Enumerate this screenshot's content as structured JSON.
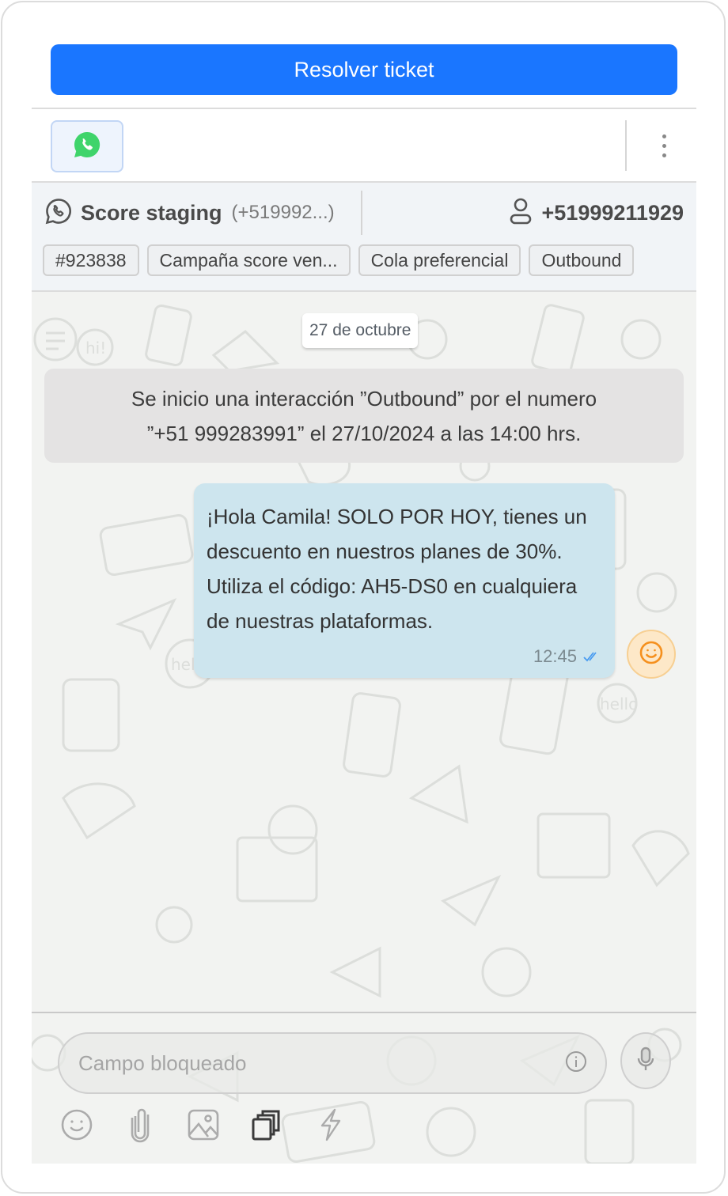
{
  "actions": {
    "resolve_label": "Resolver ticket"
  },
  "toolbar": {
    "channel_icon": "whatsapp-icon",
    "more_icon": "more-vertical-icon"
  },
  "conversation": {
    "channel_icon": "whatsapp-outline-icon",
    "channel_name": "Score staging",
    "channel_number": "(+519992...)",
    "contact_icon": "user-icon",
    "contact_phone": "+51999211929",
    "tags": [
      "#923838",
      "Campaña score ven...",
      "Cola preferencial",
      "Outbound"
    ]
  },
  "chat": {
    "date_label": "27 de octubre",
    "system_message": {
      "line1": "Se inicio una interacción ”Outbound” por el numero",
      "line2": "”+51 999283991” el  27/10/2024 a las 14:00 hrs."
    },
    "messages": [
      {
        "direction": "outgoing",
        "text": "¡Hola Camila! SOLO POR HOY, tienes un descuento en nuestros planes de 30%. Utiliza el código: AH5-DS0 en cualquiera de nuestras plataformas.",
        "time": "12:45",
        "status": "read",
        "status_icon": "double-check-icon"
      }
    ],
    "reaction_icon": "smiley-icon"
  },
  "composer": {
    "placeholder": "Campo bloqueado",
    "info_icon": "info-icon",
    "mic_icon": "microphone-icon",
    "tools": [
      "emoji-icon",
      "attachment-icon",
      "image-icon",
      "templates-icon",
      "quick-replies-icon"
    ]
  },
  "colors": {
    "primary": "#1a76ff",
    "outgoing_bubble": "#cde5ee",
    "system_bubble": "#e4e3e3",
    "whatsapp_green": "#3fd46b",
    "reaction_orange": "#f5901e",
    "read_check": "#4a9cf0"
  }
}
